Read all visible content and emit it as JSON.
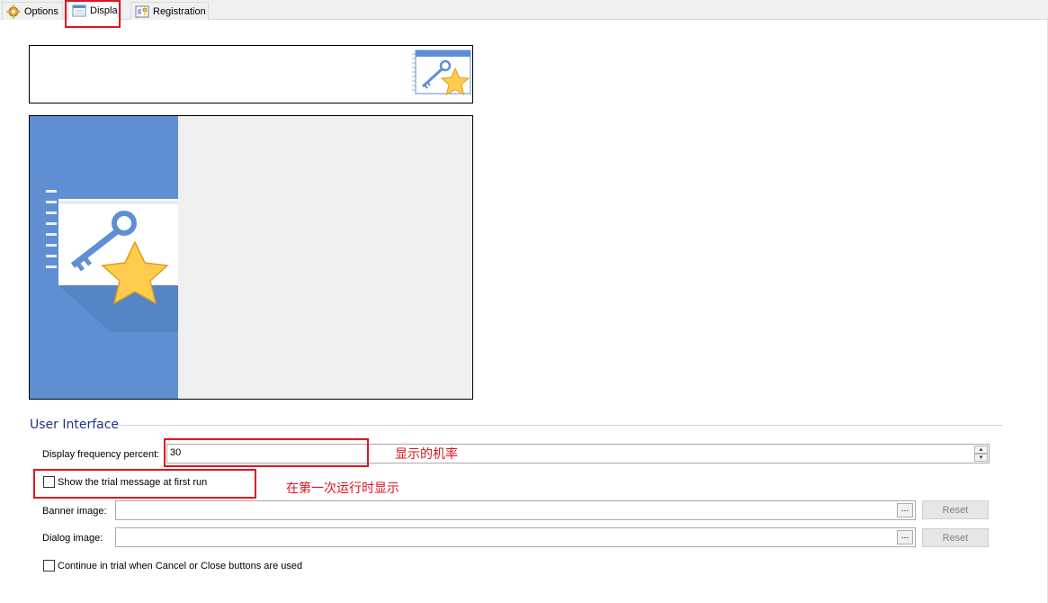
{
  "tabs": [
    {
      "label": "Options",
      "icon": "gear-icon",
      "active": false
    },
    {
      "label": "Displa",
      "icon": "display-window-icon",
      "active": true
    },
    {
      "label": "Registration",
      "icon": "registration-key-icon",
      "active": false
    }
  ],
  "group": {
    "title": "User Interface"
  },
  "frequency": {
    "label": "Display frequency percent:",
    "value": "30"
  },
  "first_run": {
    "label": "Show the trial message at first run",
    "checked": false
  },
  "banner": {
    "label": "Banner image:",
    "value": "",
    "browse_label": "...",
    "reset_label": "Reset"
  },
  "dialog": {
    "label": "Dialog image:",
    "value": "",
    "browse_label": "...",
    "reset_label": "Reset"
  },
  "continue_trial": {
    "label": "Continue in trial when Cancel or Close buttons are used",
    "checked": false
  },
  "annotations": {
    "frequency_note": "显示的机率",
    "first_run_note": "在第一次运行时显示"
  },
  "colors": {
    "highlight": "#e0141e",
    "group_title": "#1e3287",
    "preview_blue": "#5f8fd2",
    "star": "#ffcc4d"
  }
}
